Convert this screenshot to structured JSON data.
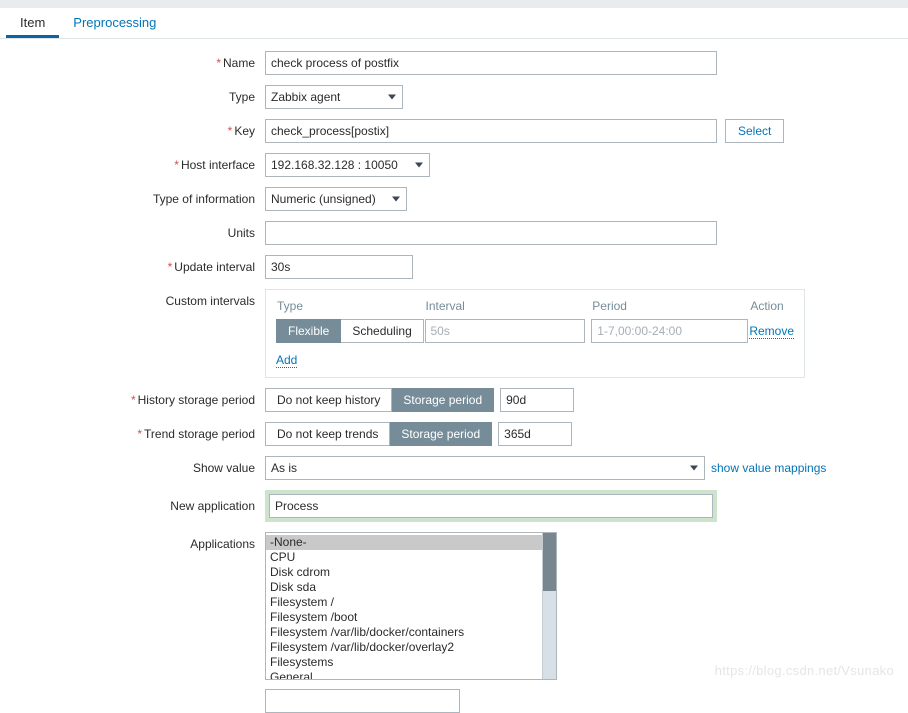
{
  "tabs": [
    {
      "label": "Item",
      "active": true
    },
    {
      "label": "Preprocessing",
      "active": false
    }
  ],
  "form": {
    "name": {
      "label": "Name",
      "required": true,
      "value": "check process of postfix"
    },
    "type": {
      "label": "Type",
      "required": false,
      "value": "Zabbix agent"
    },
    "key": {
      "label": "Key",
      "required": true,
      "value": "check_process[postix]",
      "button": "Select"
    },
    "host_interface": {
      "label": "Host interface",
      "required": true,
      "value": "192.168.32.128 : 10050"
    },
    "type_of_information": {
      "label": "Type of information",
      "required": false,
      "value": "Numeric (unsigned)"
    },
    "units": {
      "label": "Units",
      "required": false,
      "value": ""
    },
    "update_interval": {
      "label": "Update interval",
      "required": true,
      "value": "30s"
    },
    "custom_intervals": {
      "label": "Custom intervals",
      "headers": {
        "type": "Type",
        "interval": "Interval",
        "period": "Period",
        "action": "Action"
      },
      "rows": [
        {
          "type_options": [
            "Flexible",
            "Scheduling"
          ],
          "type_selected": "Flexible",
          "interval_value": "",
          "interval_placeholder": "50s",
          "period_value": "",
          "period_placeholder": "1-7,00:00-24:00",
          "action": "Remove"
        }
      ],
      "add_label": "Add"
    },
    "history_storage_period": {
      "label": "History storage period",
      "required": true,
      "options": [
        "Do not keep history",
        "Storage period"
      ],
      "selected": "Storage period",
      "value": "90d"
    },
    "trend_storage_period": {
      "label": "Trend storage period",
      "required": true,
      "options": [
        "Do not keep trends",
        "Storage period"
      ],
      "selected": "Storage period",
      "value": "365d"
    },
    "show_value": {
      "label": "Show value",
      "value": "As is",
      "link": "show value mappings"
    },
    "new_application": {
      "label": "New application",
      "value": "Process",
      "focused": true
    },
    "applications": {
      "label": "Applications",
      "options": [
        "-None-",
        "CPU",
        "Disk cdrom",
        "Disk sda",
        "Filesystem /",
        "Filesystem /boot",
        "Filesystem /var/lib/docker/containers",
        "Filesystem /var/lib/docker/overlay2",
        "Filesystems",
        "General"
      ],
      "selected": "-None-"
    }
  },
  "watermark": "https://blog.csdn.net/Vsunako",
  "colors": {
    "accent": "#0275b8",
    "active_tab_underline": "#0b62a4",
    "segment_on": "#768d99",
    "required_star": "#d64e4e",
    "focus_ring": "#cde3cd"
  }
}
